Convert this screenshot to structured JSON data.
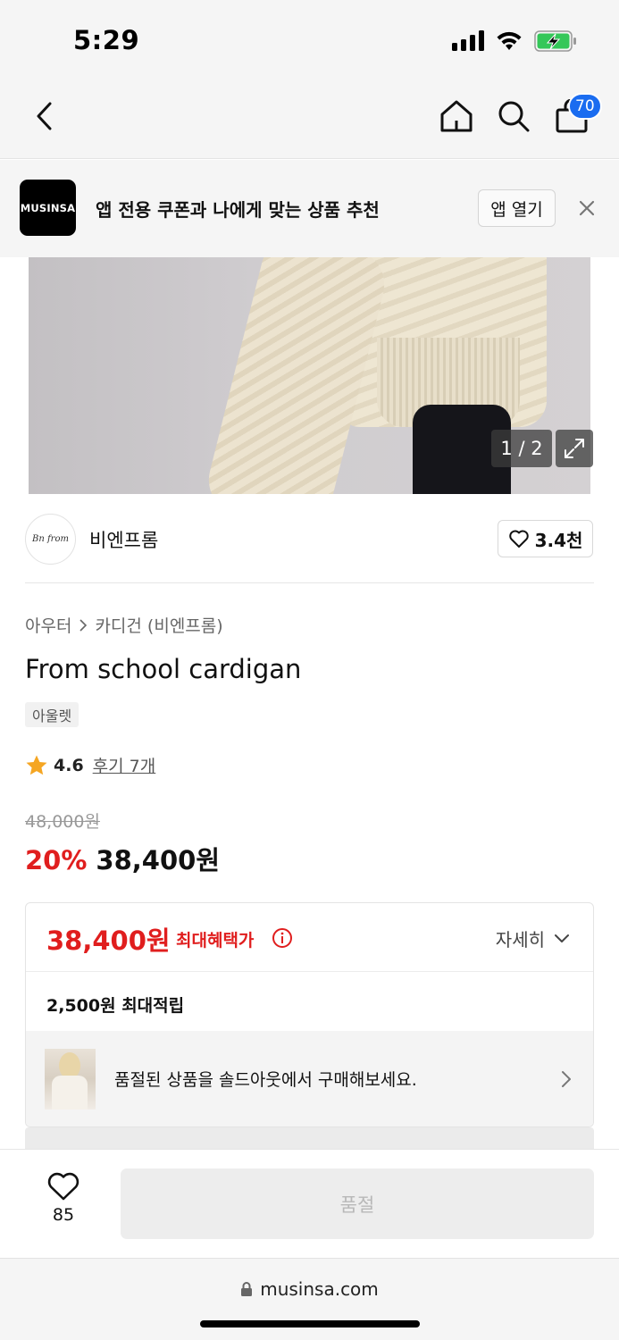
{
  "status_bar": {
    "time": "5:29"
  },
  "nav": {
    "cart_count": "70"
  },
  "app_banner": {
    "logo_text": "MUSINSA",
    "message": "앱 전용 쿠폰과 나에게 맞는 상품 추천",
    "open_label": "앱 열기"
  },
  "gallery": {
    "counter": "1 / 2"
  },
  "brand": {
    "logo_text": "Bn from",
    "name": "비엔프롬",
    "like_count": "3.4천"
  },
  "product": {
    "breadcrumb": [
      "아우터",
      "카디건 (비엔프롬)"
    ],
    "title": "From school cardigan",
    "tag": "아울렛",
    "rating": "4.6",
    "reviews": "후기 7개",
    "original_price": "48,000원",
    "discount": "20%",
    "sale_price": "38,400원"
  },
  "benefit": {
    "max_price": "38,400원",
    "max_label": "최대혜택가",
    "detail_label": "자세히",
    "points": "2,500원 최대적립",
    "soldout_message": "품절된 상품을 솔드아웃에서 구매해보세요."
  },
  "bottom_bar": {
    "wish_count": "85",
    "buy_label": "품절"
  },
  "url_bar": {
    "domain": "musinsa.com"
  },
  "colors": {
    "accent_red": "#e01e1e",
    "badge_blue": "#1a6cf0"
  }
}
